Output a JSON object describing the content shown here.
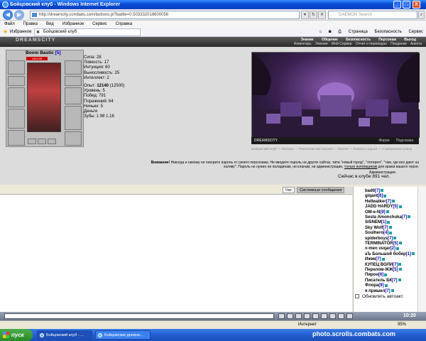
{
  "window": {
    "title": "Бойцовский клуб - Windows Internet Explorer",
    "min": "_",
    "max": "□",
    "close": "X"
  },
  "address": {
    "url": "http://dreamcity.combats.com/buttons.pl?battle=0.503332016600056",
    "search_placeholder": "DAEMON Search"
  },
  "menu": [
    "Файл",
    "Правка",
    "Вид",
    "Избранное",
    "Сервис",
    "Справка"
  ],
  "favorites": {
    "label": "Избранное",
    "tab_title": "Бойцовский клуб",
    "tools": [
      "Страница",
      "Безопасность",
      "Сервис"
    ]
  },
  "dc": {
    "logo": "DREAMSCITY",
    "menu1": [
      "Знание",
      "Общение",
      "Безопасность",
      "Персонаж",
      "Выход"
    ],
    "menu2": [
      "Инвентарь",
      "Умения",
      "Мой Сервер",
      "Отчет о переводах",
      "Поединки",
      "Анкета"
    ]
  },
  "character": {
    "name": "Boom Bastic",
    "level": "[5]",
    "hp": "195/195",
    "stats": [
      "Сила: 28",
      "Ловкость: 17",
      "Интуиция: 60",
      "Выносливость: 25",
      "Интеллект: 2"
    ],
    "experience_label": "Опыт:",
    "experience": "12140",
    "experience_next": "(12500)",
    "stats2": [
      "Уровень: 5",
      "Побед: 791",
      "Поражений: 64",
      "Ничьих: 5",
      "Деньги",
      "Зубы: 1 98 1.16"
    ]
  },
  "scene": {
    "logo": "DREAMSCITY",
    "links": [
      "Форум",
      "Подсказка"
    ],
    "nav": "Бойцовский клуб — Магазин — Ремонтная мастерская — Banner — Комната отдыха — Страшилкина улица"
  },
  "warning": {
    "bold": "Внимание!",
    "text": "Никогда и никому не говорите пароль от своего персонажа. Не вводите пароль на других сайтах, типа \"новый город\", \"лотерея\", \"там, где все дают на халяву\". Пароль не нужен ни паладинам, ни кланам, ни администрации,",
    "link": "только взломщикам",
    "tail": "для кражи вашего героя.",
    "admin": "Администрация."
  },
  "online": "Сейчас в клубе 891 чел.",
  "chat_tabs": {
    "chat": "Чат",
    "system": "Системные сообщения"
  },
  "users": [
    {
      "name": "bad0",
      "lvl": "[7]"
    },
    {
      "name": "giqant",
      "lvl": "[8]"
    },
    {
      "name": "Hellwalker",
      "lvl": "[7]"
    },
    {
      "name": "JADD HARDY",
      "lvl": "[5]"
    },
    {
      "name": "OM-e-N",
      "lvl": "[9]"
    },
    {
      "name": "Sesta Amonchuka",
      "lvl": "[7]"
    },
    {
      "name": "SISNEM",
      "lvl": "[1]"
    },
    {
      "name": "Sky Wolf",
      "lvl": "[7]"
    },
    {
      "name": "Soulhero",
      "lvl": "[4]"
    },
    {
      "name": "spiderboys",
      "lvl": "[7]"
    },
    {
      "name": "TERMINATOR",
      "lvl": "[5]"
    },
    {
      "name": "x-men vuqar",
      "lvl": "[2]"
    },
    {
      "name": "аЪ Большой бобер",
      "lvl": "[1]"
    },
    {
      "name": "Ижик",
      "lvl": "[7]"
    },
    {
      "name": "КУПЕЦ ВОЛИ",
      "lvl": "[7]"
    },
    {
      "name": "Перелом-ЖЖ",
      "lvl": "[5]"
    },
    {
      "name": "Пирон",
      "lvl": "[6]"
    },
    {
      "name": "Писатель БК",
      "lvl": "[7]"
    },
    {
      "name": "Флора",
      "lvl": "[9]"
    },
    {
      "name": "я пришел",
      "lvl": "[7]"
    }
  ],
  "autochat": "Обновлять автоакт.",
  "clock": "10:20",
  "status": {
    "zone": "Интернет",
    "zoom": "95%"
  },
  "taskbar": {
    "start": "пуск",
    "tasks": [
      "Бойцовский клуб - ...",
      "Бойцовские дневни..."
    ],
    "watermark": "photo.scrolls.combats.com"
  }
}
